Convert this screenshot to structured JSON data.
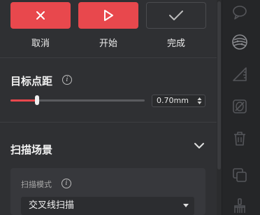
{
  "actions": {
    "cancel_label": "取消",
    "start_label": "开始",
    "done_label": "完成"
  },
  "target_spacing": {
    "title": "目标点距",
    "value": "0.70mm",
    "slider_level": 0.2
  },
  "scan_scene": {
    "title": "扫描场景",
    "mode_label": "扫描模式",
    "mode_value": "交叉线扫描"
  },
  "right_toolbar": {
    "icons": [
      "comment-icon",
      "texture-icon",
      "triangle-ruler-icon",
      "hide-icon",
      "trash-icon",
      "copy-icon",
      "brush-icon"
    ]
  },
  "colors": {
    "accent": "#e8484d",
    "panel_bg": "#2f3033",
    "toolbar_bg": "#252628"
  }
}
